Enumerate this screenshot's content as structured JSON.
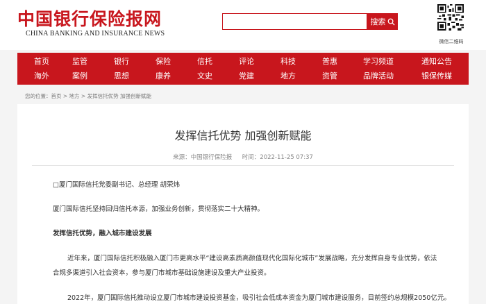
{
  "header": {
    "logo_cn": "中国银行保险报网",
    "logo_en": "CHINA BANKING AND INSURANCE NEWS",
    "search": {
      "placeholder": "",
      "button_label": "搜索"
    },
    "qr_label": "微信二维码"
  },
  "nav": {
    "row1": [
      "首页",
      "监管",
      "银行",
      "保险",
      "信托",
      "评论",
      "科技",
      "普惠",
      "学习频道",
      "通知公告"
    ],
    "row2": [
      "海外",
      "案例",
      "思想",
      "康养",
      "文史",
      "党建",
      "地方",
      "资管",
      "品牌活动",
      "银保传媒"
    ]
  },
  "breadcrumb": "您的位置：首页 > 地方 > 发挥信托优势 加强创新赋能",
  "article": {
    "title": "发挥信托优势 加强创新赋能",
    "source": "来源：中国银行保险报",
    "time": "时间：2022-11-25 07:37",
    "paragraphs": [
      "□厦门国际信托党委副书记、总经理 胡荣炜",
      "厦门国际信托坚持回归信托本源，加强业务创新，贯彻落实二十大精神。",
      "发挥信托优势，融入城市建设发展",
      "近年来，厦门国际信托积极融入厦门市更高水平“建设高素质高颜值现代化国际化城市”发展战略，充分发挥自身专业优势，依法",
      "合规多渠道引入社会资本，参与厦门市城市基础设施建设及重大产业投资。",
      "2022年，厦门国际信托推动设立厦门市城市建设投资基金，吸引社会低成本资金为厦门城市建设服务，目前签约总规模2050亿元。"
    ]
  },
  "colors": {
    "brand_red": "#c8161d"
  }
}
